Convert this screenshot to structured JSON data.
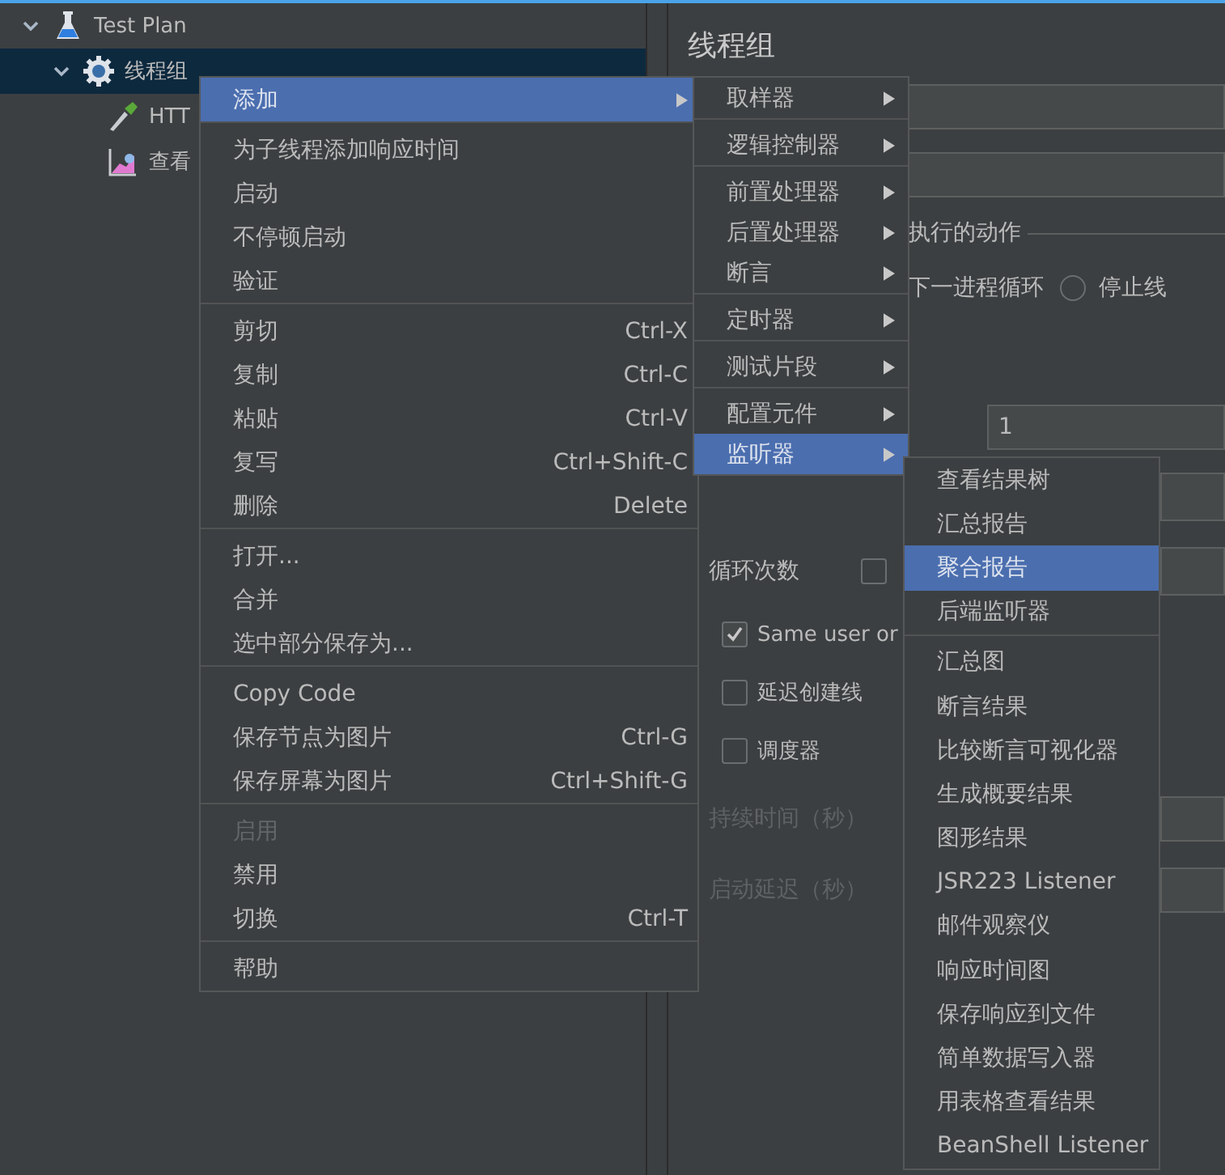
{
  "tree": [
    {
      "label": "Test Plan",
      "kind": "flask",
      "expanded": true,
      "selected": false,
      "children": [
        {
          "label": "线程组",
          "kind": "gear",
          "expanded": true,
          "selected": true,
          "children": [
            {
              "label": "HTT",
              "kind": "pipette",
              "selected": false
            },
            {
              "label": "查看",
              "kind": "chart",
              "selected": false
            }
          ]
        }
      ]
    }
  ],
  "thread_group": {
    "title": "线程组",
    "action_label": "执行的动作",
    "action_options": [
      {
        "label": "下一进程循环"
      },
      {
        "label": "停止线",
        "selected": false
      }
    ],
    "thread_count": "1",
    "loop_label": "循环次数",
    "loop_forever": {
      "checked": false
    },
    "checkboxes": [
      {
        "label": "Same user or",
        "checked": true
      },
      {
        "label": "延迟创建线",
        "checked": false
      },
      {
        "label": "调度器",
        "checked": false
      }
    ],
    "timed_fields": [
      {
        "label": "持续时间（秒）",
        "disabled": true
      },
      {
        "label": "启动延迟（秒）",
        "disabled": true
      }
    ]
  },
  "context_menu": {
    "groups": [
      [
        {
          "label": "添加",
          "submenu": true,
          "selected": true,
          "disabled": false
        }
      ],
      [
        {
          "label": "为子线程添加响应时间",
          "selected": false,
          "disabled": false
        },
        {
          "label": "启动",
          "selected": false,
          "disabled": false
        },
        {
          "label": "不停顿启动",
          "selected": false,
          "disabled": false
        },
        {
          "label": "验证",
          "selected": false,
          "disabled": false
        }
      ],
      [
        {
          "label": "剪切",
          "shortcut": "Ctrl-X",
          "selected": false,
          "disabled": false
        },
        {
          "label": "复制",
          "shortcut": "Ctrl-C",
          "selected": false,
          "disabled": false
        },
        {
          "label": "粘贴",
          "shortcut": "Ctrl-V",
          "selected": false,
          "disabled": false
        },
        {
          "label": "复写",
          "shortcut": "Ctrl+Shift-C",
          "selected": false,
          "disabled": false
        },
        {
          "label": "删除",
          "shortcut": "Delete",
          "selected": false,
          "disabled": false
        }
      ],
      [
        {
          "label": "打开...",
          "selected": false,
          "disabled": false
        },
        {
          "label": "合并",
          "selected": false,
          "disabled": false
        },
        {
          "label": "选中部分保存为...",
          "selected": false,
          "disabled": false
        }
      ],
      [
        {
          "label": "Copy Code",
          "selected": false,
          "disabled": false
        },
        {
          "label": "保存节点为图片",
          "shortcut": "Ctrl-G",
          "selected": false,
          "disabled": false
        },
        {
          "label": "保存屏幕为图片",
          "shortcut": "Ctrl+Shift-G",
          "selected": false,
          "disabled": false
        }
      ],
      [
        {
          "label": "启用",
          "selected": false,
          "disabled": true
        },
        {
          "label": "禁用",
          "selected": false,
          "disabled": false
        },
        {
          "label": "切换",
          "shortcut": "Ctrl-T",
          "selected": false,
          "disabled": false
        }
      ],
      [
        {
          "label": "帮助",
          "selected": false,
          "disabled": false
        }
      ]
    ]
  },
  "add_submenu": {
    "groups": [
      [
        {
          "label": "取样器",
          "submenu": true,
          "selected": false
        }
      ],
      [
        {
          "label": "逻辑控制器",
          "submenu": true,
          "selected": false
        }
      ],
      [
        {
          "label": "前置处理器",
          "submenu": true,
          "selected": false
        },
        {
          "label": "后置处理器",
          "submenu": true,
          "selected": false
        },
        {
          "label": "断言",
          "submenu": true,
          "selected": false
        }
      ],
      [
        {
          "label": "定时器",
          "submenu": true,
          "selected": false
        }
      ],
      [
        {
          "label": "测试片段",
          "submenu": true,
          "selected": false
        }
      ],
      [
        {
          "label": "配置元件",
          "submenu": true,
          "selected": false
        },
        {
          "label": "监听器",
          "submenu": true,
          "selected": true
        }
      ]
    ]
  },
  "listener_submenu": {
    "groups": [
      [
        {
          "label": "查看结果树",
          "selected": false
        },
        {
          "label": "汇总报告",
          "selected": false
        },
        {
          "label": "聚合报告",
          "selected": true
        },
        {
          "label": "后端监听器",
          "selected": false
        }
      ],
      [
        {
          "label": "汇总图",
          "selected": false
        },
        {
          "label": "断言结果",
          "selected": false
        },
        {
          "label": "比较断言可视化器",
          "selected": false
        },
        {
          "label": "生成概要结果",
          "selected": false
        },
        {
          "label": "图形结果",
          "selected": false
        },
        {
          "label": "JSR223 Listener",
          "selected": false
        },
        {
          "label": "邮件观察仪",
          "selected": false
        },
        {
          "label": "响应时间图",
          "selected": false
        },
        {
          "label": "保存响应到文件",
          "selected": false
        },
        {
          "label": "简单数据写入器",
          "selected": false
        },
        {
          "label": "用表格查看结果",
          "selected": false
        },
        {
          "label": "BeanShell Listener",
          "selected": false
        }
      ]
    ]
  }
}
